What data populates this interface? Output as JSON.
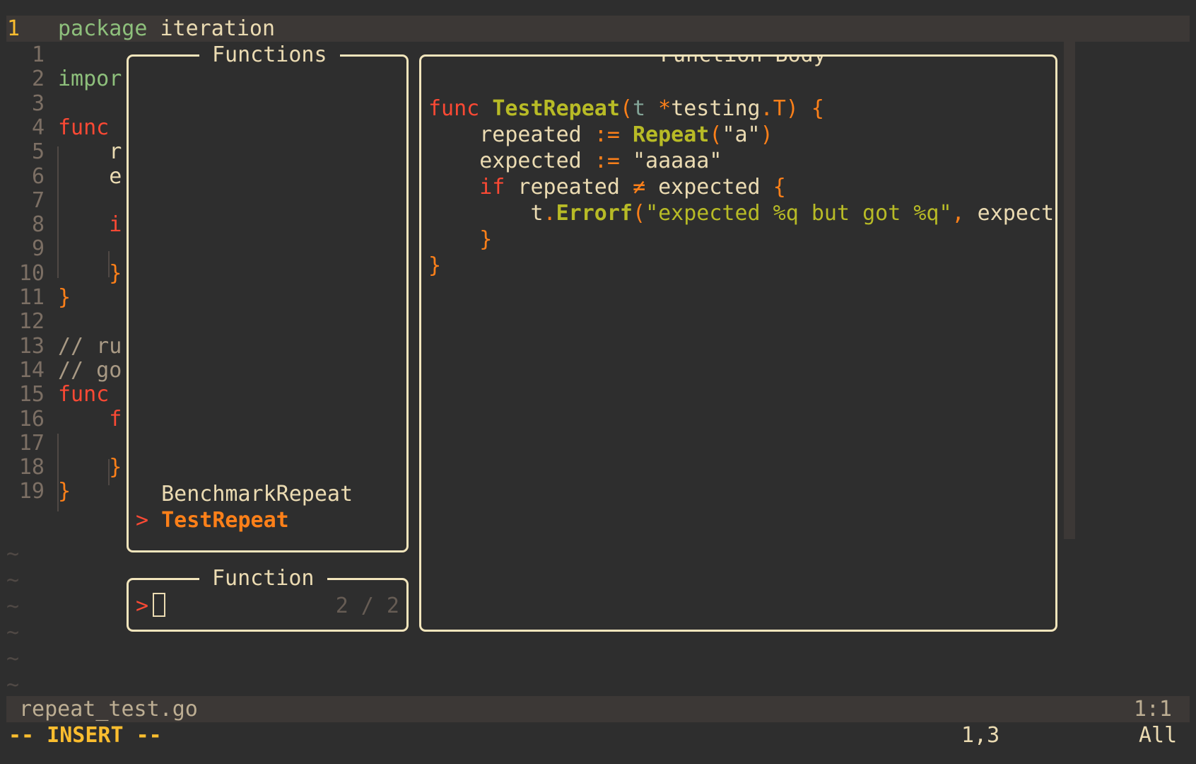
{
  "editor": {
    "current_line_number": "1",
    "current_line_parts": [
      {
        "text": "package",
        "cls": "kw-green"
      },
      {
        "text": " iteration",
        "cls": "plain"
      }
    ],
    "lines": [
      {
        "num": "1",
        "parts": []
      },
      {
        "num": "2",
        "parts": [
          {
            "text": "impor",
            "cls": "kw-green"
          }
        ]
      },
      {
        "num": "3",
        "parts": []
      },
      {
        "num": "4",
        "parts": [
          {
            "text": "func",
            "cls": "kw-red"
          }
        ]
      },
      {
        "num": "5",
        "parts": [
          {
            "text": "    r",
            "cls": "plain"
          }
        ]
      },
      {
        "num": "6",
        "parts": [
          {
            "text": "    e",
            "cls": "plain"
          }
        ]
      },
      {
        "num": "7",
        "parts": []
      },
      {
        "num": "8",
        "parts": [
          {
            "text": "    i",
            "cls": "kw-red"
          }
        ]
      },
      {
        "num": "9",
        "parts": []
      },
      {
        "num": "10",
        "parts": [
          {
            "text": "    }",
            "cls": "brace"
          }
        ]
      },
      {
        "num": "11",
        "parts": [
          {
            "text": "}",
            "cls": "brace"
          }
        ]
      },
      {
        "num": "12",
        "parts": []
      },
      {
        "num": "13",
        "parts": [
          {
            "text": "// ru",
            "cls": "cmt"
          }
        ]
      },
      {
        "num": "14",
        "parts": [
          {
            "text": "// go",
            "cls": "cmt"
          }
        ]
      },
      {
        "num": "15",
        "parts": [
          {
            "text": "func",
            "cls": "kw-red"
          }
        ]
      },
      {
        "num": "16",
        "parts": [
          {
            "text": "    f",
            "cls": "kw-red"
          }
        ]
      },
      {
        "num": "17",
        "parts": []
      },
      {
        "num": "18",
        "parts": [
          {
            "text": "    }",
            "cls": "brace"
          }
        ]
      },
      {
        "num": "19",
        "parts": [
          {
            "text": "}",
            "cls": "brace"
          }
        ]
      }
    ],
    "tilde": "~"
  },
  "functions_panel": {
    "title": "Functions",
    "items": [
      {
        "prefix": " ",
        "label": "BenchmarkRepeat",
        "selected": false
      },
      {
        "prefix": ">",
        "label": "TestRepeat",
        "selected": true
      }
    ]
  },
  "function_input": {
    "title": "Function",
    "prompt": ">",
    "value": "",
    "count": "2 / 2"
  },
  "body_panel": {
    "title": "Function Body",
    "lines": [
      [
        {
          "text": "func",
          "cls": "kw-red"
        },
        {
          "text": " ",
          "cls": "plain"
        },
        {
          "text": "TestRepeat",
          "cls": "fn"
        },
        {
          "text": "(",
          "cls": "op"
        },
        {
          "text": "t",
          "cls": "param"
        },
        {
          "text": " ",
          "cls": "plain"
        },
        {
          "text": "*",
          "cls": "op"
        },
        {
          "text": "testing",
          "cls": "plain"
        },
        {
          "text": ".",
          "cls": "op"
        },
        {
          "text": "T",
          "cls": "op"
        },
        {
          "text": ")",
          "cls": "op"
        },
        {
          "text": " {",
          "cls": "brace"
        }
      ],
      [
        {
          "text": "    repeated ",
          "cls": "plain"
        },
        {
          "text": ":=",
          "cls": "op"
        },
        {
          "text": " ",
          "cls": "plain"
        },
        {
          "text": "Repeat",
          "cls": "fn"
        },
        {
          "text": "(",
          "cls": "op"
        },
        {
          "text": "\"a\"",
          "cls": "plain"
        },
        {
          "text": ")",
          "cls": "op"
        }
      ],
      [
        {
          "text": "    expected ",
          "cls": "plain"
        },
        {
          "text": ":=",
          "cls": "op"
        },
        {
          "text": " ",
          "cls": "plain"
        },
        {
          "text": "\"aaaaa\"",
          "cls": "plain"
        }
      ],
      [
        {
          "text": "    ",
          "cls": "plain"
        },
        {
          "text": "if",
          "cls": "kw-red"
        },
        {
          "text": " repeated ",
          "cls": "plain"
        },
        {
          "text": "≠",
          "cls": "op"
        },
        {
          "text": " expected ",
          "cls": "plain"
        },
        {
          "text": "{",
          "cls": "brace"
        }
      ],
      [
        {
          "text": "        t",
          "cls": "plain"
        },
        {
          "text": ".",
          "cls": "op"
        },
        {
          "text": "Errorf",
          "cls": "fn"
        },
        {
          "text": "(",
          "cls": "op"
        },
        {
          "text": "\"expected %q but got %q\"",
          "cls": "str"
        },
        {
          "text": ",",
          "cls": "op"
        },
        {
          "text": " expect",
          "cls": "plain"
        }
      ],
      [
        {
          "text": "    }",
          "cls": "brace"
        }
      ],
      [
        {
          "text": "}",
          "cls": "brace"
        }
      ]
    ]
  },
  "statusline": {
    "filename": "repeat_test.go",
    "position": "1:1"
  },
  "modeline": {
    "mode": "-- INSERT --",
    "cursor": "1,3",
    "scroll": "All"
  }
}
